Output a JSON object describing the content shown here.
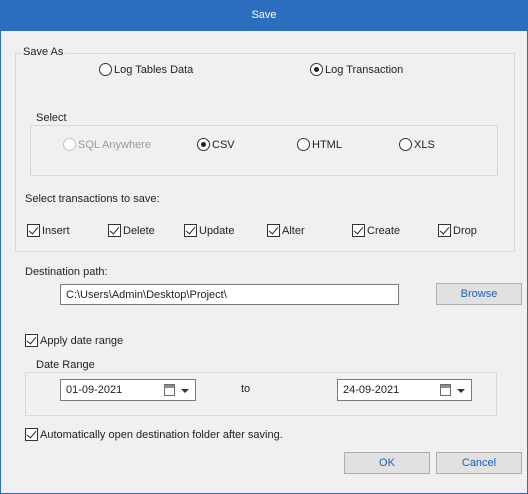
{
  "window": {
    "title": "Save"
  },
  "save_as": {
    "label": "Save As",
    "options": [
      {
        "label": "Log Tables Data",
        "selected": false
      },
      {
        "label": "Log Transaction",
        "selected": true
      }
    ]
  },
  "select": {
    "label": "Select",
    "options": [
      {
        "label": "SQL Anywhere",
        "selected": false,
        "disabled": true
      },
      {
        "label": "CSV",
        "selected": true,
        "disabled": false
      },
      {
        "label": "HTML",
        "selected": false,
        "disabled": false
      },
      {
        "label": "XLS",
        "selected": false,
        "disabled": false
      }
    ]
  },
  "transactions": {
    "label": "Select transactions to save:",
    "items": [
      {
        "label": "Insert",
        "checked": true
      },
      {
        "label": "Delete",
        "checked": true
      },
      {
        "label": "Update",
        "checked": true
      },
      {
        "label": "Alter",
        "checked": true
      },
      {
        "label": "Create",
        "checked": true
      },
      {
        "label": "Drop",
        "checked": true
      }
    ]
  },
  "destination": {
    "label": "Destination path:",
    "value": "C:\\Users\\Admin\\Desktop\\Project\\",
    "browse_label": "Browse"
  },
  "apply_date_range": {
    "label": "Apply date range",
    "checked": true
  },
  "date_range": {
    "label": "Date Range",
    "from": "01-09-2021",
    "to_label": "to",
    "to": "24-09-2021"
  },
  "auto_open": {
    "label": "Automatically open destination folder after saving.",
    "checked": true
  },
  "buttons": {
    "ok": "OK",
    "cancel": "Cancel"
  },
  "colors": {
    "title_bar": "#2a6ebd",
    "window_bg": "#f0f0f0",
    "button_text": "#1a5fb4"
  }
}
